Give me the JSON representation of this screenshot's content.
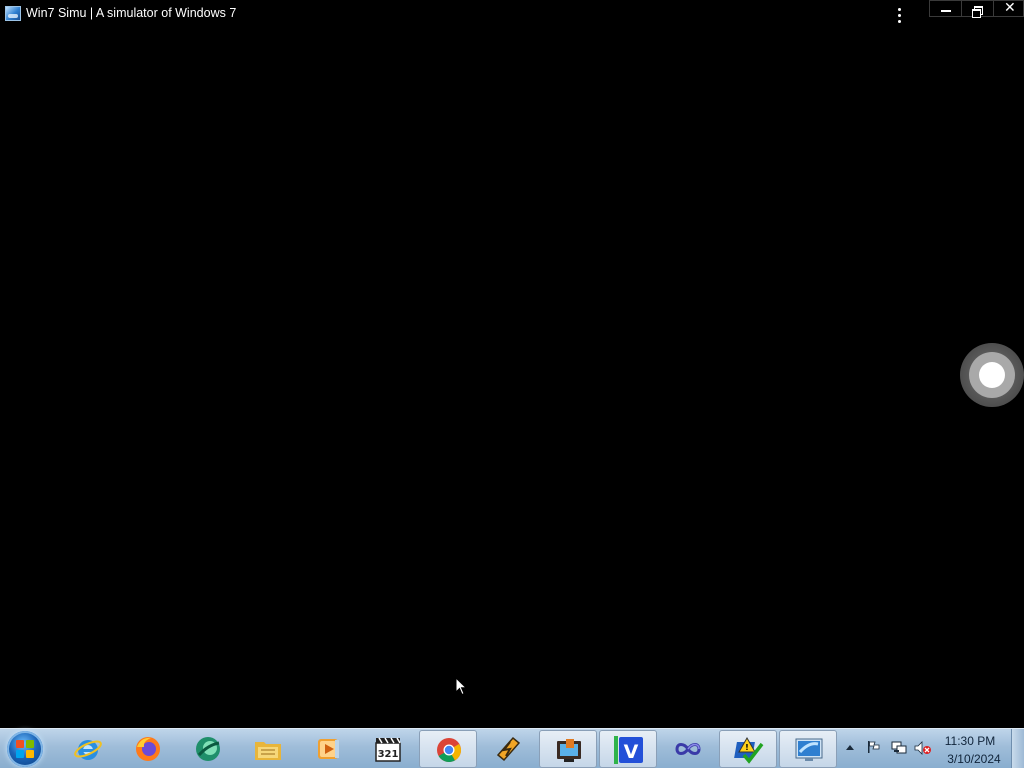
{
  "window": {
    "title": "Win7 Simu | A simulator of Windows 7",
    "icon": "win7-simu-app-icon",
    "controls": [
      "minimize-icon",
      "restore-icon",
      "close-icon"
    ]
  },
  "taskbar": {
    "start": "windows-start-orb",
    "pinned": [
      {
        "name": "internet-explorer",
        "icon": "internet-explorer-icon"
      },
      {
        "name": "firefox",
        "icon": "firefox-icon"
      },
      {
        "name": "green-browser",
        "icon": "green-globe-icon"
      },
      {
        "name": "windows-explorer",
        "icon": "folder-icon"
      },
      {
        "name": "media-player",
        "icon": "media-player-icon"
      },
      {
        "name": "media-player-classic",
        "icon": "clapperboard-321-icon"
      },
      {
        "name": "chrome",
        "icon": "chrome-icon",
        "active": true
      },
      {
        "name": "winamp",
        "icon": "winamp-lightning-icon"
      },
      {
        "name": "tv-app",
        "icon": "tv-icon",
        "active": true
      },
      {
        "name": "v-app",
        "icon": "blue-v-icon",
        "active": true
      },
      {
        "name": "infinity-app",
        "icon": "infinity-icon"
      },
      {
        "name": "action-center",
        "icon": "warning-checkmark-icon",
        "active": true
      },
      {
        "name": "remote-desktop",
        "icon": "monitor-icon",
        "active": true
      }
    ],
    "tray": {
      "icons": [
        "show-hidden-icons-arrow",
        "action-center-flag-icon",
        "network-icon",
        "volume-muted-icon"
      ],
      "time": "11:30 PM",
      "date": "3/10/2024"
    }
  },
  "colors": {
    "desktop": "#000000",
    "taskbar": "#9fbdd9",
    "accent": "#1b64b7"
  }
}
